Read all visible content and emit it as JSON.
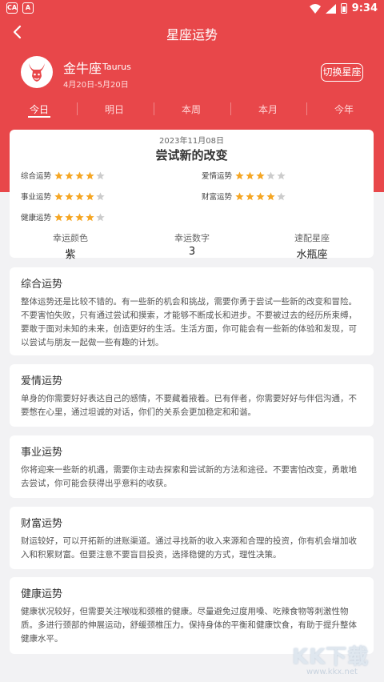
{
  "status_bar": {
    "time": "9:34",
    "left_icon_1": "CA",
    "left_icon_2": "A"
  },
  "header": {
    "title": "星座运势"
  },
  "sign": {
    "name": "金牛座",
    "english": "Taurus",
    "dates": "4月20日-5月20日",
    "switch_label": "切换星座",
    "icon": "bull-icon"
  },
  "tabs": [
    {
      "label": "今日",
      "active": true
    },
    {
      "label": "明日",
      "active": false
    },
    {
      "label": "本周",
      "active": false
    },
    {
      "label": "本月",
      "active": false
    },
    {
      "label": "今年",
      "active": false
    }
  ],
  "summary": {
    "date": "2023年11月08日",
    "title": "尝试新的改变",
    "ratings": [
      {
        "label": "综合运势",
        "stars": 4,
        "max": 5
      },
      {
        "label": "爱情运势",
        "stars": 3,
        "max": 5
      },
      {
        "label": "事业运势",
        "stars": 4,
        "max": 5
      },
      {
        "label": "财富运势",
        "stars": 4,
        "max": 5
      },
      {
        "label": "健康运势",
        "stars": 4,
        "max": 5
      }
    ],
    "lucky": [
      {
        "label": "幸运颜色",
        "value": "紫"
      },
      {
        "label": "幸运数字",
        "value": "3"
      },
      {
        "label": "速配星座",
        "value": "水瓶座"
      }
    ]
  },
  "sections": [
    {
      "title": "综合运势",
      "text": "整体运势还是比较不错的。有一些新的机会和挑战，需要你勇于尝试一些新的改变和冒险。不要害怕失败，只有通过尝试和摸索，才能够不断成长和进步。不要被过去的经历所束缚，要敢于面对未知的未来，创造更好的生活。生活方面，你可能会有一些新的体验和发现，可以尝试与朋友一起做一些有趣的计划。"
    },
    {
      "title": "爱情运势",
      "text": "单身的你需要好好表达自己的感情，不要藏着掖着。已有伴者，你需要好好与伴侣沟通，不要憋在心里，通过坦诚的对话，你们的关系会更加稳定和和谐。"
    },
    {
      "title": "事业运势",
      "text": "你将迎来一些新的机遇，需要你主动去探索和尝试新的方法和途径。不要害怕改变，勇敢地去尝试，你可能会获得出乎意料的收获。"
    },
    {
      "title": "财富运势",
      "text": "财运较好，可以开拓新的进账渠道。通过寻找新的收入来源和合理的投资，你有机会增加收入和积累财富。但要注意不要盲目投资，选择稳健的方式，理性决策。"
    },
    {
      "title": "健康运势",
      "text": "健康状况较好，但需要关注喉咙和颈椎的健康。尽量避免过度用嗓、吃辣食物等刺激性物质。多进行颈部的伸展运动，舒缓颈椎压力。保持身体的平衡和健康饮食，有助于提升整体健康水平。"
    }
  ],
  "watermark": {
    "big": "KK下载",
    "small": "www.kkx.net"
  },
  "colors": {
    "accent": "#e8474a",
    "star_on": "#f5a623",
    "star_off": "#cccccc"
  }
}
